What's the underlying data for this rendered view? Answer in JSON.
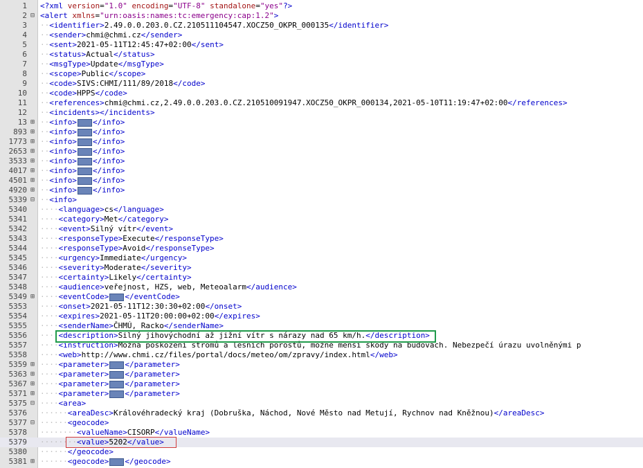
{
  "editor": {
    "lines": [
      {
        "num": "1",
        "fold": "",
        "indent": 0,
        "segments": [
          {
            "t": "tag",
            "v": "<?xml "
          },
          {
            "t": "attr",
            "v": "version"
          },
          {
            "t": "txt",
            "v": "="
          },
          {
            "t": "val",
            "v": "\"1.0\""
          },
          {
            "t": "txt",
            "v": " "
          },
          {
            "t": "attr",
            "v": "encoding"
          },
          {
            "t": "txt",
            "v": "="
          },
          {
            "t": "val",
            "v": "\"UTF-8\""
          },
          {
            "t": "txt",
            "v": " "
          },
          {
            "t": "attr",
            "v": "standalone"
          },
          {
            "t": "txt",
            "v": "="
          },
          {
            "t": "val",
            "v": "\"yes\""
          },
          {
            "t": "tag",
            "v": "?>"
          }
        ]
      },
      {
        "num": "2",
        "fold": "⊟",
        "indent": 0,
        "segments": [
          {
            "t": "tag",
            "v": "<alert "
          },
          {
            "t": "attr",
            "v": "xmlns"
          },
          {
            "t": "txt",
            "v": "="
          },
          {
            "t": "val",
            "v": "\"urn:oasis:names:tc:emergency:cap:1.2\""
          },
          {
            "t": "tag",
            "v": ">"
          }
        ]
      },
      {
        "num": "3",
        "fold": "",
        "indent": 1,
        "segments": [
          {
            "t": "tag",
            "v": "<identifier>"
          },
          {
            "t": "txt",
            "v": "2.49.0.0.203.0.CZ.210511104547.XOCZ50_OKPR_000135"
          },
          {
            "t": "tag",
            "v": "</identifier>"
          }
        ]
      },
      {
        "num": "4",
        "fold": "",
        "indent": 1,
        "segments": [
          {
            "t": "tag",
            "v": "<sender>"
          },
          {
            "t": "txt",
            "v": "chmi@chmi.cz"
          },
          {
            "t": "tag",
            "v": "</sender>"
          }
        ]
      },
      {
        "num": "5",
        "fold": "",
        "indent": 1,
        "segments": [
          {
            "t": "tag",
            "v": "<sent>"
          },
          {
            "t": "txt",
            "v": "2021-05-11T12:45:47+02:00"
          },
          {
            "t": "tag",
            "v": "</sent>"
          }
        ]
      },
      {
        "num": "6",
        "fold": "",
        "indent": 1,
        "segments": [
          {
            "t": "tag",
            "v": "<status>"
          },
          {
            "t": "txt",
            "v": "Actual"
          },
          {
            "t": "tag",
            "v": "</status>"
          }
        ]
      },
      {
        "num": "7",
        "fold": "",
        "indent": 1,
        "segments": [
          {
            "t": "tag",
            "v": "<msgType>"
          },
          {
            "t": "txt",
            "v": "Update"
          },
          {
            "t": "tag",
            "v": "</msgType>"
          }
        ]
      },
      {
        "num": "8",
        "fold": "",
        "indent": 1,
        "segments": [
          {
            "t": "tag",
            "v": "<scope>"
          },
          {
            "t": "txt",
            "v": "Public"
          },
          {
            "t": "tag",
            "v": "</scope>"
          }
        ]
      },
      {
        "num": "9",
        "fold": "",
        "indent": 1,
        "segments": [
          {
            "t": "tag",
            "v": "<code>"
          },
          {
            "t": "txt",
            "v": "SIVS:CHMI/111/89/2018"
          },
          {
            "t": "tag",
            "v": "</code>"
          }
        ]
      },
      {
        "num": "10",
        "fold": "",
        "indent": 1,
        "segments": [
          {
            "t": "tag",
            "v": "<code>"
          },
          {
            "t": "txt",
            "v": "HPPS"
          },
          {
            "t": "tag",
            "v": "</code>"
          }
        ]
      },
      {
        "num": "11",
        "fold": "",
        "indent": 1,
        "segments": [
          {
            "t": "tag",
            "v": "<references>"
          },
          {
            "t": "txt",
            "v": "chmi@chmi.cz,2.49.0.0.203.0.CZ.210510091947.XOCZ50_OKPR_000134,2021-05-10T11:19:47+02:00"
          },
          {
            "t": "tag",
            "v": "</references>"
          }
        ]
      },
      {
        "num": "12",
        "fold": "",
        "indent": 1,
        "segments": [
          {
            "t": "tag",
            "v": "<incidents>"
          },
          {
            "t": "tag",
            "v": "</incidents>"
          }
        ]
      },
      {
        "num": "13",
        "fold": "⊞",
        "indent": 1,
        "segments": [
          {
            "t": "tag",
            "v": "<info>"
          },
          {
            "t": "box"
          },
          {
            "t": "tag",
            "v": "</info>"
          }
        ]
      },
      {
        "num": "893",
        "fold": "⊞",
        "indent": 1,
        "segments": [
          {
            "t": "tag",
            "v": "<info>"
          },
          {
            "t": "box"
          },
          {
            "t": "tag",
            "v": "</info>"
          }
        ]
      },
      {
        "num": "1773",
        "fold": "⊞",
        "indent": 1,
        "segments": [
          {
            "t": "tag",
            "v": "<info>"
          },
          {
            "t": "box"
          },
          {
            "t": "tag",
            "v": "</info>"
          }
        ]
      },
      {
        "num": "2653",
        "fold": "⊞",
        "indent": 1,
        "segments": [
          {
            "t": "tag",
            "v": "<info>"
          },
          {
            "t": "box"
          },
          {
            "t": "tag",
            "v": "</info>"
          }
        ]
      },
      {
        "num": "3533",
        "fold": "⊞",
        "indent": 1,
        "segments": [
          {
            "t": "tag",
            "v": "<info>"
          },
          {
            "t": "box"
          },
          {
            "t": "tag",
            "v": "</info>"
          }
        ]
      },
      {
        "num": "4017",
        "fold": "⊞",
        "indent": 1,
        "segments": [
          {
            "t": "tag",
            "v": "<info>"
          },
          {
            "t": "box"
          },
          {
            "t": "tag",
            "v": "</info>"
          }
        ]
      },
      {
        "num": "4501",
        "fold": "⊞",
        "indent": 1,
        "segments": [
          {
            "t": "tag",
            "v": "<info>"
          },
          {
            "t": "box"
          },
          {
            "t": "tag",
            "v": "</info>"
          }
        ]
      },
      {
        "num": "4920",
        "fold": "⊞",
        "indent": 1,
        "segments": [
          {
            "t": "tag",
            "v": "<info>"
          },
          {
            "t": "box"
          },
          {
            "t": "tag",
            "v": "</info>"
          }
        ]
      },
      {
        "num": "5339",
        "fold": "⊟",
        "indent": 1,
        "segments": [
          {
            "t": "tag",
            "v": "<info>"
          }
        ]
      },
      {
        "num": "5340",
        "fold": "",
        "indent": 2,
        "segments": [
          {
            "t": "tag",
            "v": "<language>"
          },
          {
            "t": "txt",
            "v": "cs"
          },
          {
            "t": "tag",
            "v": "</language>"
          }
        ]
      },
      {
        "num": "5341",
        "fold": "",
        "indent": 2,
        "segments": [
          {
            "t": "tag",
            "v": "<category>"
          },
          {
            "t": "txt",
            "v": "Met"
          },
          {
            "t": "tag",
            "v": "</category>"
          }
        ]
      },
      {
        "num": "5342",
        "fold": "",
        "indent": 2,
        "segments": [
          {
            "t": "tag",
            "v": "<event>"
          },
          {
            "t": "txt",
            "v": "Silný vítr"
          },
          {
            "t": "tag",
            "v": "</event>"
          }
        ]
      },
      {
        "num": "5343",
        "fold": "",
        "indent": 2,
        "segments": [
          {
            "t": "tag",
            "v": "<responseType>"
          },
          {
            "t": "txt",
            "v": "Execute"
          },
          {
            "t": "tag",
            "v": "</responseType>"
          }
        ]
      },
      {
        "num": "5344",
        "fold": "",
        "indent": 2,
        "segments": [
          {
            "t": "tag",
            "v": "<responseType>"
          },
          {
            "t": "txt",
            "v": "Avoid"
          },
          {
            "t": "tag",
            "v": "</responseType>"
          }
        ]
      },
      {
        "num": "5345",
        "fold": "",
        "indent": 2,
        "segments": [
          {
            "t": "tag",
            "v": "<urgency>"
          },
          {
            "t": "txt",
            "v": "Immediate"
          },
          {
            "t": "tag",
            "v": "</urgency>"
          }
        ]
      },
      {
        "num": "5346",
        "fold": "",
        "indent": 2,
        "segments": [
          {
            "t": "tag",
            "v": "<severity>"
          },
          {
            "t": "txt",
            "v": "Moderate"
          },
          {
            "t": "tag",
            "v": "</severity>"
          }
        ]
      },
      {
        "num": "5347",
        "fold": "",
        "indent": 2,
        "segments": [
          {
            "t": "tag",
            "v": "<certainty>"
          },
          {
            "t": "txt",
            "v": "Likely"
          },
          {
            "t": "tag",
            "v": "</certainty>"
          }
        ]
      },
      {
        "num": "5348",
        "fold": "",
        "indent": 2,
        "segments": [
          {
            "t": "tag",
            "v": "<audience>"
          },
          {
            "t": "txt",
            "v": "veřejnost, HZS, web, Meteoalarm"
          },
          {
            "t": "tag",
            "v": "</audience>"
          }
        ]
      },
      {
        "num": "5349",
        "fold": "⊞",
        "indent": 2,
        "segments": [
          {
            "t": "tag",
            "v": "<eventCode>"
          },
          {
            "t": "box"
          },
          {
            "t": "tag",
            "v": "</eventCode>"
          }
        ]
      },
      {
        "num": "5353",
        "fold": "",
        "indent": 2,
        "segments": [
          {
            "t": "tag",
            "v": "<onset>"
          },
          {
            "t": "txt",
            "v": "2021-05-11T12:30:30+02:00"
          },
          {
            "t": "tag",
            "v": "</onset>"
          }
        ]
      },
      {
        "num": "5354",
        "fold": "",
        "indent": 2,
        "segments": [
          {
            "t": "tag",
            "v": "<expires>"
          },
          {
            "t": "txt",
            "v": "2021-05-11T20:00:00+02:00"
          },
          {
            "t": "tag",
            "v": "</expires>"
          }
        ]
      },
      {
        "num": "5355",
        "fold": "",
        "indent": 2,
        "segments": [
          {
            "t": "tag",
            "v": "<senderName>"
          },
          {
            "t": "txt",
            "v": "ČHMÚ, Racko"
          },
          {
            "t": "tag",
            "v": "</senderName>"
          }
        ]
      },
      {
        "num": "5356",
        "fold": "",
        "indent": 2,
        "segments": [
          {
            "t": "tag",
            "v": "<description>"
          },
          {
            "t": "txt",
            "v": "Silný jihovýchodní až jižní vítr s nárazy nad 65 km/h."
          },
          {
            "t": "tag",
            "v": "</description>"
          }
        ]
      },
      {
        "num": "5357",
        "fold": "",
        "indent": 2,
        "segments": [
          {
            "t": "tag",
            "v": "<instruction>"
          },
          {
            "t": "txt",
            "v": "Možná poškození stromů a lesních porostů, možné menší škody na budovách. Nebezpečí úrazu uvolněnými p"
          }
        ]
      },
      {
        "num": "5358",
        "fold": "",
        "indent": 2,
        "segments": [
          {
            "t": "tag",
            "v": "<web>"
          },
          {
            "t": "txt",
            "v": "http://www.chmi.cz/files/portal/docs/meteo/om/zpravy/index.html"
          },
          {
            "t": "tag",
            "v": "</web>"
          }
        ]
      },
      {
        "num": "5359",
        "fold": "⊞",
        "indent": 2,
        "segments": [
          {
            "t": "tag",
            "v": "<parameter>"
          },
          {
            "t": "box"
          },
          {
            "t": "tag",
            "v": "</parameter>"
          }
        ]
      },
      {
        "num": "5363",
        "fold": "⊞",
        "indent": 2,
        "segments": [
          {
            "t": "tag",
            "v": "<parameter>"
          },
          {
            "t": "box"
          },
          {
            "t": "tag",
            "v": "</parameter>"
          }
        ]
      },
      {
        "num": "5367",
        "fold": "⊞",
        "indent": 2,
        "segments": [
          {
            "t": "tag",
            "v": "<parameter>"
          },
          {
            "t": "box"
          },
          {
            "t": "tag",
            "v": "</parameter>"
          }
        ]
      },
      {
        "num": "5371",
        "fold": "⊞",
        "indent": 2,
        "segments": [
          {
            "t": "tag",
            "v": "<parameter>"
          },
          {
            "t": "box"
          },
          {
            "t": "tag",
            "v": "</parameter>"
          }
        ]
      },
      {
        "num": "5375",
        "fold": "⊟",
        "indent": 2,
        "segments": [
          {
            "t": "tag",
            "v": "<area>"
          }
        ]
      },
      {
        "num": "5376",
        "fold": "",
        "indent": 3,
        "segments": [
          {
            "t": "tag",
            "v": "<areaDesc>"
          },
          {
            "t": "txt",
            "v": "Královéhradecký kraj (Dobruška, Náchod, Nové Město nad Metují, Rychnov nad Kněžnou)"
          },
          {
            "t": "tag",
            "v": "</areaDesc>"
          }
        ]
      },
      {
        "num": "5377",
        "fold": "⊟",
        "indent": 3,
        "segments": [
          {
            "t": "tag",
            "v": "<geocode>"
          }
        ]
      },
      {
        "num": "5378",
        "fold": "",
        "indent": 4,
        "segments": [
          {
            "t": "tag",
            "v": "<valueName>"
          },
          {
            "t": "txt",
            "v": "CISORP"
          },
          {
            "t": "tag",
            "v": "</valueName>"
          }
        ]
      },
      {
        "num": "5379",
        "fold": "",
        "indent": 4,
        "segments": [
          {
            "t": "tag",
            "v": "<value>"
          },
          {
            "t": "txt",
            "v": "5202"
          },
          {
            "t": "tag",
            "v": "</value>"
          }
        ]
      },
      {
        "num": "5380",
        "fold": "",
        "indent": 3,
        "segments": [
          {
            "t": "tag",
            "v": "</geocode>"
          }
        ]
      },
      {
        "num": "5381",
        "fold": "⊞",
        "indent": 3,
        "segments": [
          {
            "t": "tag",
            "v": "<geocode>"
          },
          {
            "t": "box"
          },
          {
            "t": "tag",
            "v": "</geocode>"
          }
        ]
      }
    ],
    "current_line": "5379",
    "highlight_green_line": "5356",
    "highlight_red_line": "5379",
    "colors": {
      "tag": "#0000cc",
      "attribute": "#a31515",
      "attribute_value": "#8b008b",
      "highlight_green": "#1f9a4a",
      "highlight_red": "#d23b3b"
    }
  }
}
